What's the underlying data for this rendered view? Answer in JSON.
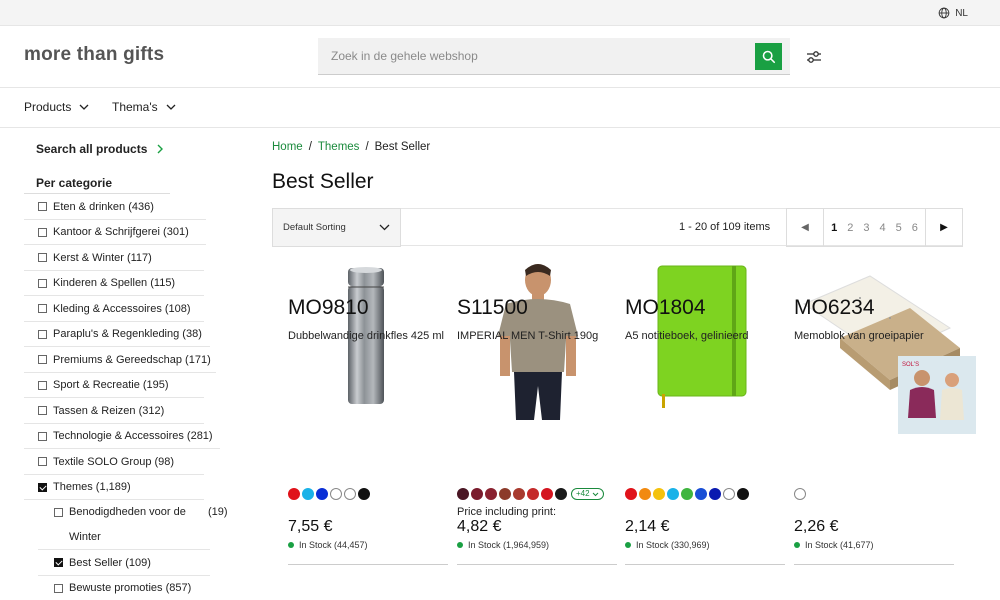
{
  "topbar": {
    "language": "NL"
  },
  "header": {
    "logo": "more than gifts",
    "search_placeholder": "Zoek in de gehele webshop"
  },
  "nav": {
    "products": "Products",
    "themes": "Thema's"
  },
  "sidebar": {
    "search_all": "Search all products",
    "per_category": "Per categorie",
    "categories": [
      {
        "label": "Eten & drinken (436)",
        "checked": false
      },
      {
        "label": "Kantoor & Schrijfgerei (301)",
        "checked": false
      },
      {
        "label": "Kerst & Winter (117)",
        "checked": false
      },
      {
        "label": "Kinderen & Spellen (115)",
        "checked": false
      },
      {
        "label": "Kleding & Accessoires (108)",
        "checked": false
      },
      {
        "label": "Paraplu's & Regenkleding (38)",
        "checked": false
      },
      {
        "label": "Premiums & Gereedschap (171)",
        "checked": false
      },
      {
        "label": "Sport & Recreatie (195)",
        "checked": false
      },
      {
        "label": "Tassen & Reizen (312)",
        "checked": false
      },
      {
        "label": "Technologie & Accessoires (281)",
        "checked": false
      },
      {
        "label": "Textile SOLO Group (98)",
        "checked": false
      },
      {
        "label": "Themes (1,189)",
        "checked": true
      }
    ],
    "subcategories": [
      {
        "label": "Benodigdheden voor de Winter",
        "count": "(19)",
        "checked": false
      },
      {
        "label": "Best Seller (109)",
        "checked": true
      },
      {
        "label": "Bewuste promoties (857)",
        "checked": false
      }
    ]
  },
  "breadcrumb": {
    "home": "Home",
    "themes": "Themes",
    "current": "Best Seller",
    "sep": "/"
  },
  "page_title": "Best Seller",
  "toolbar": {
    "sort_label": "Default Sorting",
    "count": "1 - 20 of 109 items",
    "pages": [
      "1",
      "2",
      "3",
      "4",
      "5",
      "6"
    ],
    "current_page": "1"
  },
  "products": [
    {
      "code": "MO9810",
      "name": "Dubbelwandige drinkfles 425 ml",
      "colors": [
        "#e0131a",
        "#1ab2e8",
        "#0a2fd6",
        "#ffffff",
        "#ffffff",
        "#111111"
      ],
      "print_label": "",
      "price": "7,55 €",
      "stock": "In Stock (44,457)"
    },
    {
      "code": "S11500",
      "name": "IMPERIAL MEN T-Shirt 190g",
      "colors": [
        "#4a1624",
        "#7a1b2c",
        "#8a2230",
        "#8c3a2a",
        "#a83a2e",
        "#c42a2a",
        "#d4141f",
        "#1a1a1a"
      ],
      "more": "+42",
      "print_label": "Price including print:",
      "price": "4,82 €",
      "stock": "In Stock (1,964,959)"
    },
    {
      "code": "MO1804",
      "name": "A5 notitieboek, gelinieerd",
      "colors": [
        "#e0131a",
        "#f28a10",
        "#f4c20d",
        "#1ab2e8",
        "#3fb53f",
        "#1a4fd6",
        "#0a1ab0",
        "#ffffff",
        "#111111"
      ],
      "print_label": "",
      "price": "2,14 €",
      "stock": "In Stock (330,969)"
    },
    {
      "code": "MO6234",
      "name": "Memoblok van groeipapier",
      "colors": [
        "#ffffff"
      ],
      "print_label": "",
      "price": "2,26 €",
      "stock": "In Stock (41,677)"
    }
  ]
}
